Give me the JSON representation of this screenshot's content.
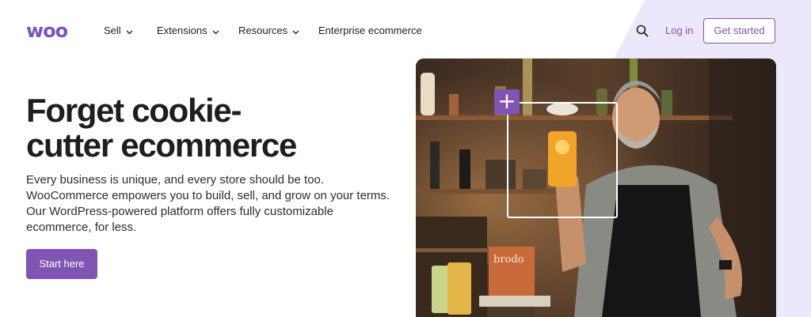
{
  "brand": {
    "logo_text": "woo",
    "accent": "#7f54b3",
    "lavender": "#ede7fb"
  },
  "nav": {
    "items": [
      {
        "label": "Sell",
        "has_dropdown": true
      },
      {
        "label": "Extensions",
        "has_dropdown": true
      },
      {
        "label": "Resources",
        "has_dropdown": true
      },
      {
        "label": "Enterprise ecommerce",
        "has_dropdown": false
      }
    ],
    "search_icon": "search-icon",
    "login_label": "Log in",
    "get_started_label": "Get started"
  },
  "hero": {
    "title_line1": "Forget cookie-",
    "title_line2": "cutter ecommerce",
    "body_line1": "Every business is unique, and every store should be too.",
    "body_line2": "WooCommerce empowers you to build, sell, and grow on your terms.",
    "body_line3": "Our WordPress-powered platform offers fully customizable",
    "body_line4": "ecommerce, for less.",
    "cta_label": "Start here"
  },
  "image": {
    "product_label": "brodo",
    "plus_icon": "plus-icon"
  }
}
